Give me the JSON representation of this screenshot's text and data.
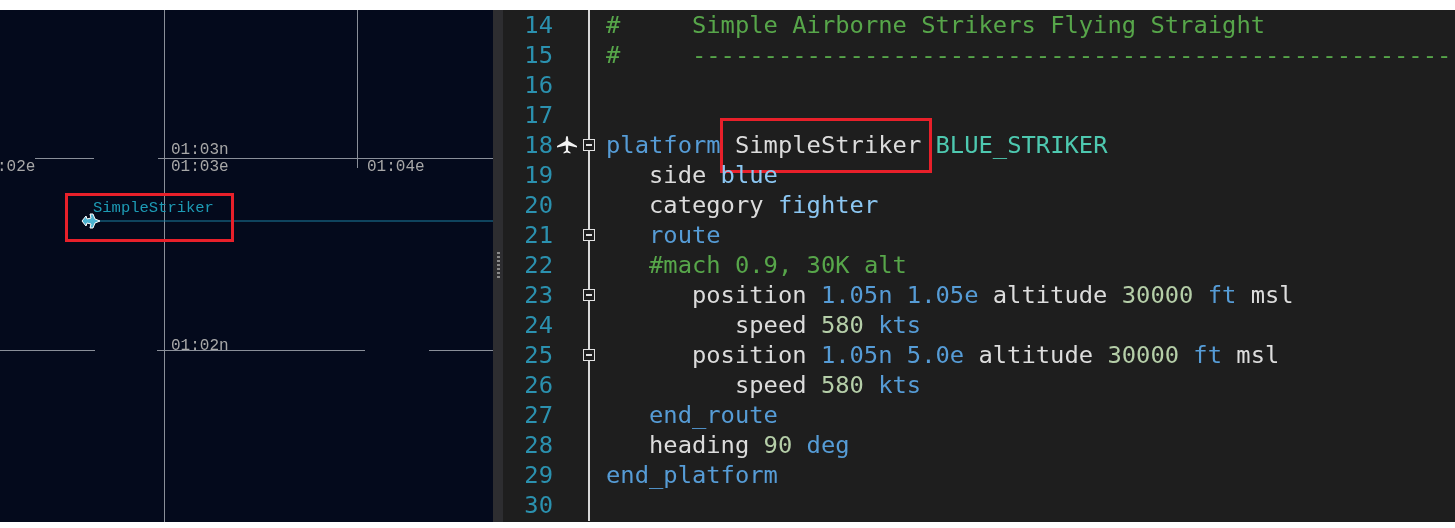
{
  "map": {
    "grid_labels": [
      {
        "text": "01:03n"
      },
      {
        "text": ":02e"
      },
      {
        "text": "01:03e"
      },
      {
        "text": "01:04e"
      },
      {
        "text": "01:02n"
      }
    ],
    "platform": {
      "label": "SimpleStriker",
      "highlighted": true
    }
  },
  "editor": {
    "lines": [
      {
        "number": "14",
        "tokens": [
          {
            "text": "#     Simple Airborne Strikers Flying Straight",
            "kind": "comment"
          }
        ]
      },
      {
        "number": "15",
        "tokens": [
          {
            "text": "#     -----------------------------------------------------",
            "kind": "comment"
          }
        ]
      },
      {
        "number": "16"
      },
      {
        "number": "17"
      },
      {
        "number": "18",
        "marker": true,
        "expanded": true,
        "tokens": [
          {
            "text": "platform",
            "kind": "keyword"
          },
          {
            "text": "SimpleStriker",
            "kind": "plain",
            "highlighted": true
          },
          {
            "text": "BLUE_STRIKER",
            "kind": "type"
          }
        ]
      },
      {
        "number": "19",
        "tokens": [
          {
            "text": "   side",
            "kind": "plain"
          },
          {
            "text": "blue",
            "kind": "value"
          }
        ]
      },
      {
        "number": "20",
        "tokens": [
          {
            "text": "   category",
            "kind": "plain"
          },
          {
            "text": "fighter",
            "kind": "value"
          }
        ]
      },
      {
        "number": "21",
        "expanded": true,
        "tokens": [
          {
            "text": "   route",
            "kind": "keyword"
          }
        ]
      },
      {
        "number": "22",
        "tokens": [
          {
            "text": "   #mach 0.9, 30K alt",
            "kind": "comment"
          }
        ]
      },
      {
        "number": "23",
        "expanded": true,
        "tokens": [
          {
            "text": "      position",
            "kind": "plain"
          },
          {
            "text": "1.05n",
            "kind": "keyword"
          },
          {
            "text": "1.05e",
            "kind": "keyword"
          },
          {
            "text": "altitude",
            "kind": "plain"
          },
          {
            "text": "30000",
            "kind": "number"
          },
          {
            "text": "ft",
            "kind": "keyword"
          },
          {
            "text": "msl",
            "kind": "plain"
          }
        ]
      },
      {
        "number": "24",
        "tokens": [
          {
            "text": "         speed",
            "kind": "plain"
          },
          {
            "text": "580",
            "kind": "number"
          },
          {
            "text": "kts",
            "kind": "keyword"
          }
        ]
      },
      {
        "number": "25",
        "expanded": true,
        "tokens": [
          {
            "text": "      position",
            "kind": "plain"
          },
          {
            "text": "1.05n",
            "kind": "keyword"
          },
          {
            "text": "5.0e",
            "kind": "keyword"
          },
          {
            "text": "altitude",
            "kind": "plain"
          },
          {
            "text": "30000",
            "kind": "number"
          },
          {
            "text": "ft",
            "kind": "keyword"
          },
          {
            "text": "msl",
            "kind": "plain"
          }
        ]
      },
      {
        "number": "26",
        "tokens": [
          {
            "text": "         speed",
            "kind": "plain"
          },
          {
            "text": "580",
            "kind": "number"
          },
          {
            "text": "kts",
            "kind": "keyword"
          }
        ]
      },
      {
        "number": "27",
        "tokens": [
          {
            "text": "   end_route",
            "kind": "keyword"
          }
        ]
      },
      {
        "number": "28",
        "tokens": [
          {
            "text": "   heading",
            "kind": "plain"
          },
          {
            "text": "90",
            "kind": "number"
          },
          {
            "text": "deg",
            "kind": "keyword"
          }
        ]
      },
      {
        "number": "29",
        "tokens": [
          {
            "text": "end_platform",
            "kind": "keyword"
          }
        ]
      },
      {
        "number": "30"
      }
    ]
  }
}
